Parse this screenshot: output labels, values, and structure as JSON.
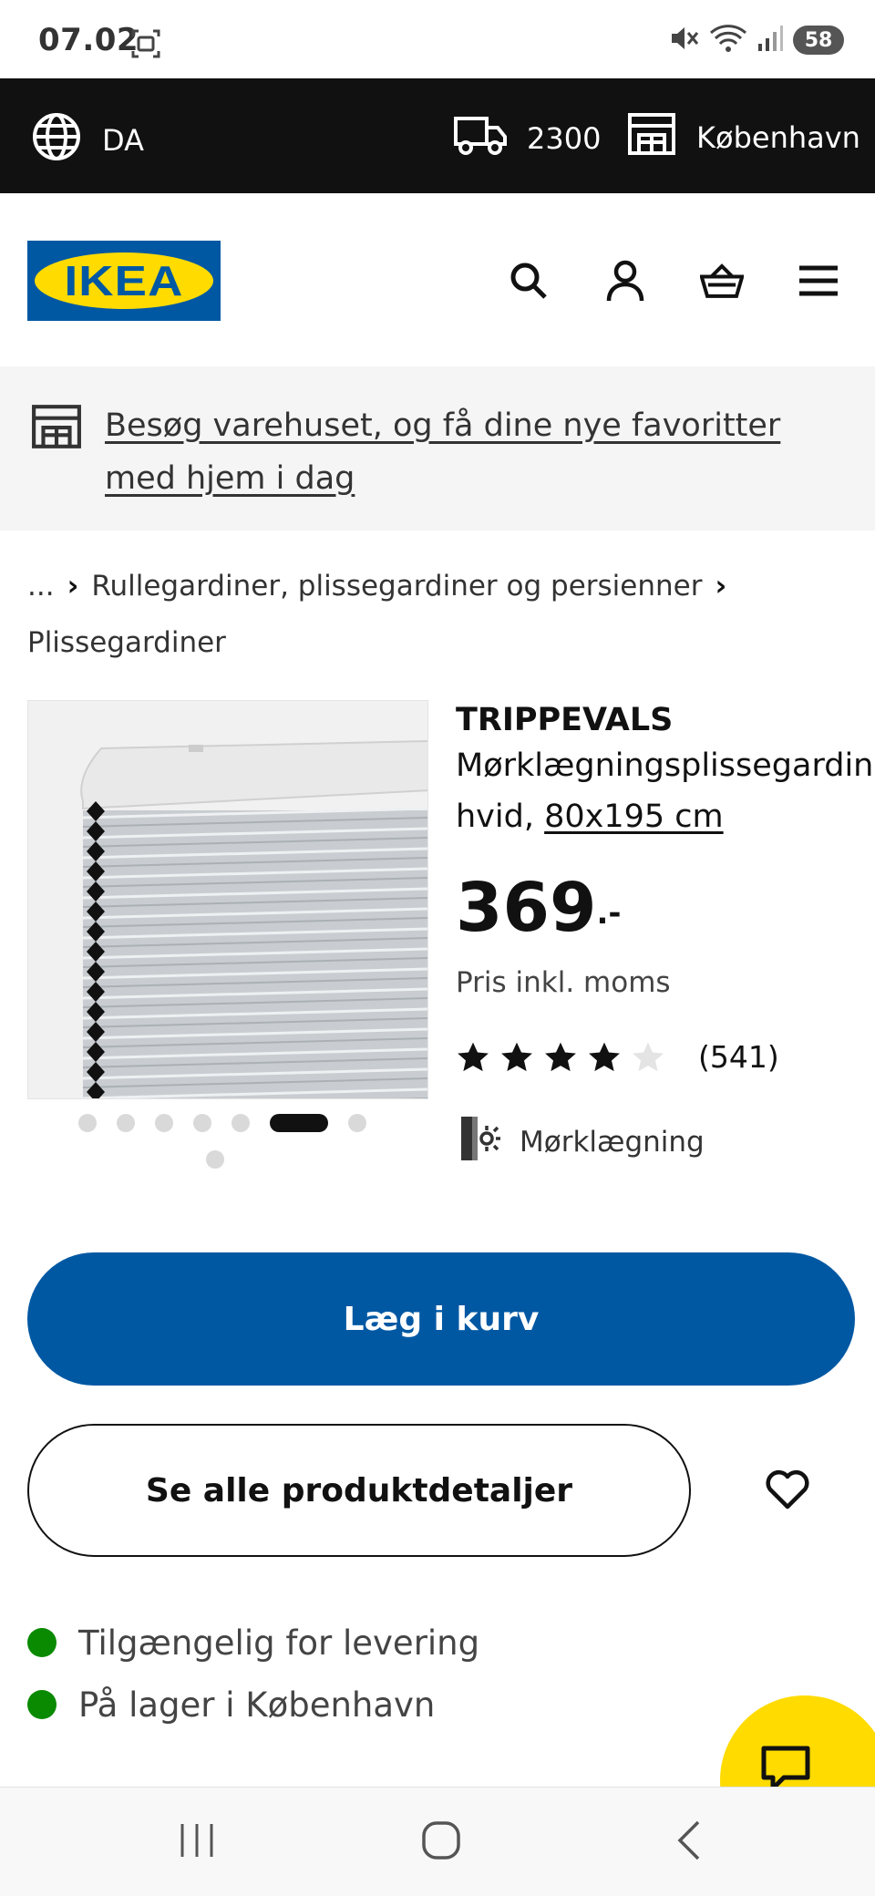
{
  "status_bar": {
    "time": "07.02",
    "battery": "58",
    "icons": [
      "screenshot-icon",
      "mute-icon",
      "wifi-icon",
      "signal-icon",
      "battery-icon"
    ]
  },
  "top_bar": {
    "language": "DA",
    "postal_code": "2300",
    "store": "København",
    "icons": [
      "globe-icon",
      "delivery-truck-icon",
      "store-icon"
    ]
  },
  "header": {
    "logo_text": "IKEA",
    "icons": [
      "search-icon",
      "account-icon",
      "shopping-bag-icon",
      "menu-icon"
    ]
  },
  "banner": {
    "text": "Besøg varehuset, og få dine nye favoritter med hjem i dag",
    "icon": "store-icon"
  },
  "breadcrumb": {
    "ellipsis": "...",
    "items": [
      "Rullegardiner, plissegardiner og persienner",
      "Plissegardiner"
    ],
    "separator": "›"
  },
  "gallery": {
    "image_count": 8,
    "active_index": 5
  },
  "product": {
    "name": "TRIPPEVALS",
    "description": "Mørklægningsplissegardin,",
    "color": "hvid,",
    "size": "80x195 cm",
    "price": "369",
    "price_suffix": ".-",
    "price_note": "Pris inkl. moms",
    "rating": 4,
    "rating_max": 5,
    "review_count": "(541)",
    "feature": "Mørklægning"
  },
  "actions": {
    "add_to_cart": "Læg i kurv",
    "details": "Se alle produktdetaljer"
  },
  "availability": {
    "delivery": "Tilgængelig for levering",
    "stock": "På lager i København"
  },
  "colors": {
    "brand_blue": "#0058a3",
    "brand_yellow": "#ffdb00",
    "available_green": "#0a8a00"
  }
}
